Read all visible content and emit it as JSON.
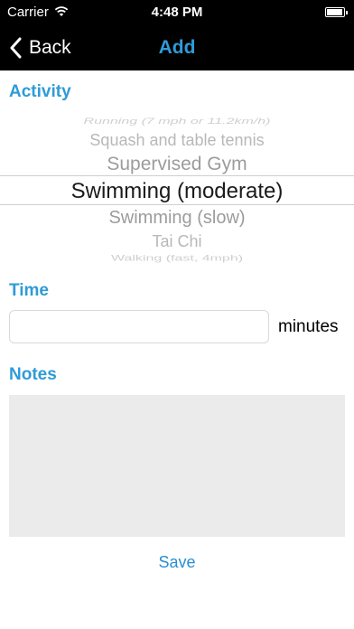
{
  "status_bar": {
    "carrier": "Carrier",
    "time": "4:48 PM"
  },
  "nav": {
    "back_label": "Back",
    "title": "Add"
  },
  "activity": {
    "label": "Activity",
    "options": [
      "Running (7 mph or 11.2km/h)",
      "Squash and table tennis",
      "Supervised Gym",
      "Swimming (moderate)",
      "Swimming (slow)",
      "Tai Chi",
      "Walking (fast, 4mph)"
    ],
    "selected": "Swimming (moderate)"
  },
  "time": {
    "label": "Time",
    "value": "",
    "unit": "minutes"
  },
  "notes": {
    "label": "Notes",
    "value": ""
  },
  "save_label": "Save",
  "colors": {
    "accent": "#2f9bd8",
    "bar_background": "#000000",
    "notes_background": "#ebebeb"
  }
}
